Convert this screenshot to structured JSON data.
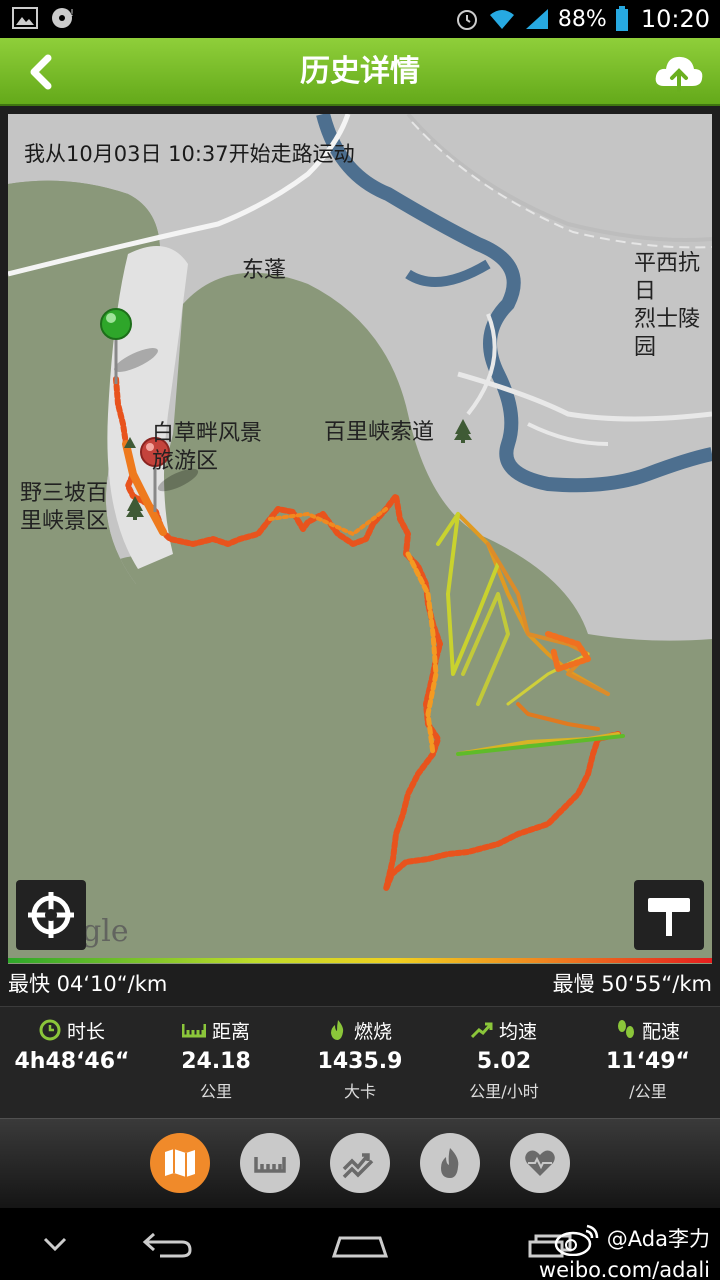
{
  "status_bar": {
    "battery": "88%",
    "time": "10:20"
  },
  "header": {
    "title": "历史详情"
  },
  "map": {
    "start_text": "我从10月03日 10:37开始走路运动",
    "labels": {
      "dongpeng": "东蓬",
      "pingxi_line1": "平西抗日",
      "pingxi_line2": "烈士陵园",
      "suodao": "百里峡索道",
      "baicao_line1": "白草畔风景",
      "baicao_line2": "旅游区",
      "yesanpo_line1": "野三坡百",
      "yesanpo_line2": "里峡景区"
    },
    "google": "Google",
    "fastest": "最快 04‘10“/km",
    "slowest": "最慢 50‘55“/km"
  },
  "stats": [
    {
      "label": "时长",
      "value": "4h48‘46“",
      "unit": "",
      "icon": "clock-icon"
    },
    {
      "label": "距离",
      "value": "24.18",
      "unit": "公里",
      "icon": "ruler-icon"
    },
    {
      "label": "燃烧",
      "value": "1435.9",
      "unit": "大卡",
      "icon": "flame-icon"
    },
    {
      "label": "均速",
      "value": "5.02",
      "unit": "公里/小时",
      "icon": "trend-icon"
    },
    {
      "label": "配速",
      "value": "11‘49“",
      "unit": "/公里",
      "icon": "footsteps-icon"
    }
  ],
  "tabs": [
    {
      "name": "map",
      "active": true
    },
    {
      "name": "ruler",
      "active": false
    },
    {
      "name": "speed",
      "active": false
    },
    {
      "name": "calorie",
      "active": false
    },
    {
      "name": "heart",
      "active": false
    }
  ],
  "watermark": {
    "line1": "@Ada李力",
    "line2": "weibo.com/adali"
  },
  "colors": {
    "header_green": "#7cc12b",
    "active_tab": "#f08a2a",
    "map_land": "#8a987a",
    "river": "#4d6f8f"
  }
}
